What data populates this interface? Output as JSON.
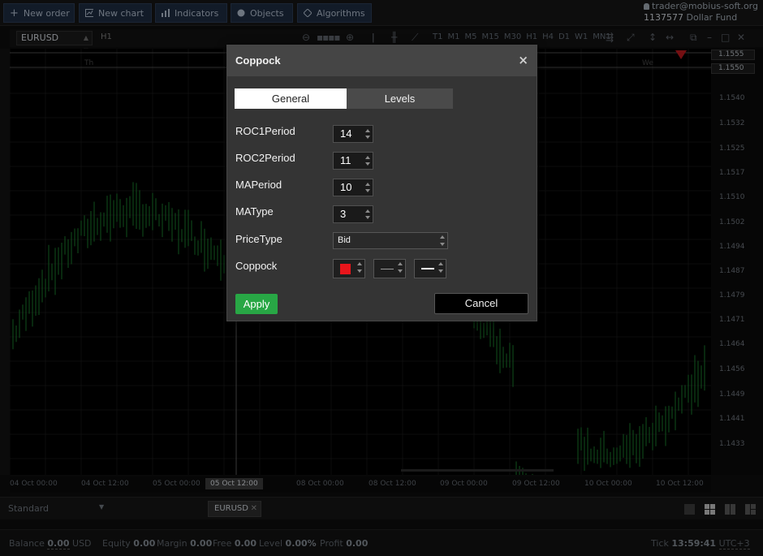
{
  "toolbar": {
    "new_order": "New order",
    "new_chart": "New chart",
    "indicators": "Indicators",
    "objects": "Objects",
    "algorithms": "Algorithms"
  },
  "account": {
    "user": "trader@mobius-soft.org",
    "number": "1137577",
    "fund": "Dollar Fund"
  },
  "chart_toolbar": {
    "symbol": "EURUSD",
    "timeframe": "H1",
    "timeframes": [
      "T1",
      "M1",
      "M5",
      "M15",
      "M30",
      "H1",
      "H4",
      "D1",
      "W1",
      "MN1"
    ]
  },
  "chart": {
    "day_labels": [
      "Th",
      "We"
    ],
    "price_labels": [
      "1.1555",
      "1.1550",
      "1.1540",
      "1.1532",
      "1.1525",
      "1.1517",
      "1.1510",
      "1.1502",
      "1.1494",
      "1.1487",
      "1.1479",
      "1.1471",
      "1.1464",
      "1.1456",
      "1.1449",
      "1.1441",
      "1.1433"
    ],
    "time_labels": [
      "04 Oct 00:00",
      "04 Oct 12:00",
      "05 Oct 00:00",
      "05 Oct 12:00",
      "08 Oct 00:00",
      "08 Oct 12:00",
      "09 Oct 00:00",
      "09 Oct 12:00",
      "10 Oct 00:00",
      "10 Oct 12:00"
    ],
    "candle_color": "#1a7a2c"
  },
  "bottom_tabs": {
    "layout": "Standard",
    "chart_tab": "EURUSD"
  },
  "status": {
    "balance_label": "Balance",
    "balance": "0.00",
    "currency": "USD",
    "equity_label": "Equity",
    "equity": "0.00",
    "margin_label": "Margin",
    "margin": "0.00",
    "free_label": "Free",
    "free": "0.00",
    "level_label": "Level",
    "level": "0.00%",
    "profit_label": "Profit",
    "profit": "0.00",
    "tick_label": "Tick",
    "time": "13:59:41",
    "timezone": "UTC+3"
  },
  "dialog": {
    "title": "Coppock",
    "close": "×",
    "tabs": [
      "General",
      "Levels"
    ],
    "fields": {
      "roc1_label": "ROC1Period",
      "roc1_value": "14",
      "roc2_label": "ROC2Period",
      "roc2_value": "11",
      "maperiod_label": "MAPeriod",
      "maperiod_value": "10",
      "matype_label": "MAType",
      "matype_value": "3",
      "pricetype_label": "PriceType",
      "pricetype_value": "Bid",
      "coppock_label": "Coppock"
    },
    "coppock_color": "#e8151b",
    "apply": "Apply",
    "cancel": "Cancel"
  }
}
